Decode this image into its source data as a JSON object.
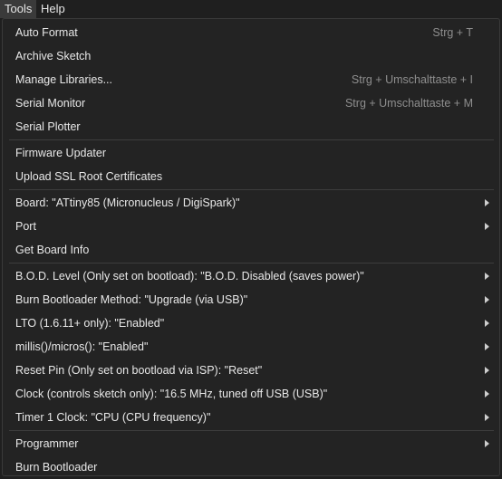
{
  "menubar": {
    "tools": "Tools",
    "help": "Help"
  },
  "menu": {
    "auto_format": {
      "label": "Auto Format",
      "shortcut": "Strg + T"
    },
    "archive_sketch": {
      "label": "Archive Sketch"
    },
    "manage_libraries": {
      "label": "Manage Libraries...",
      "shortcut": "Strg + Umschalttaste + I"
    },
    "serial_monitor": {
      "label": "Serial Monitor",
      "shortcut": "Strg + Umschalttaste + M"
    },
    "serial_plotter": {
      "label": "Serial Plotter"
    },
    "firmware_updater": {
      "label": "Firmware Updater"
    },
    "upload_ssl": {
      "label": "Upload SSL Root Certificates"
    },
    "board": {
      "label": "Board: \"ATtiny85 (Micronucleus / DigiSpark)\""
    },
    "port": {
      "label": "Port"
    },
    "get_board_info": {
      "label": "Get Board Info"
    },
    "bod_level": {
      "label": "B.O.D. Level (Only set on bootload): \"B.O.D. Disabled (saves power)\""
    },
    "burn_bootloader_method": {
      "label": "Burn Bootloader Method: \"Upgrade (via USB)\""
    },
    "lto": {
      "label": "LTO (1.6.11+ only): \"Enabled\""
    },
    "millis": {
      "label": "millis()/micros(): \"Enabled\""
    },
    "reset_pin": {
      "label": "Reset Pin (Only set on bootload via ISP): \"Reset\""
    },
    "clock": {
      "label": "Clock (controls sketch only): \"16.5 MHz, tuned off USB (USB)\""
    },
    "timer1_clock": {
      "label": "Timer 1 Clock: \"CPU (CPU frequency)\""
    },
    "programmer": {
      "label": "Programmer"
    },
    "burn_bootloader": {
      "label": "Burn Bootloader"
    }
  },
  "colors": {
    "background": "#1f1f1f",
    "menu_background": "#232323",
    "text": "#e8e8e8",
    "shortcut_text": "#8e8e8e",
    "separator": "#3d3d3d"
  }
}
